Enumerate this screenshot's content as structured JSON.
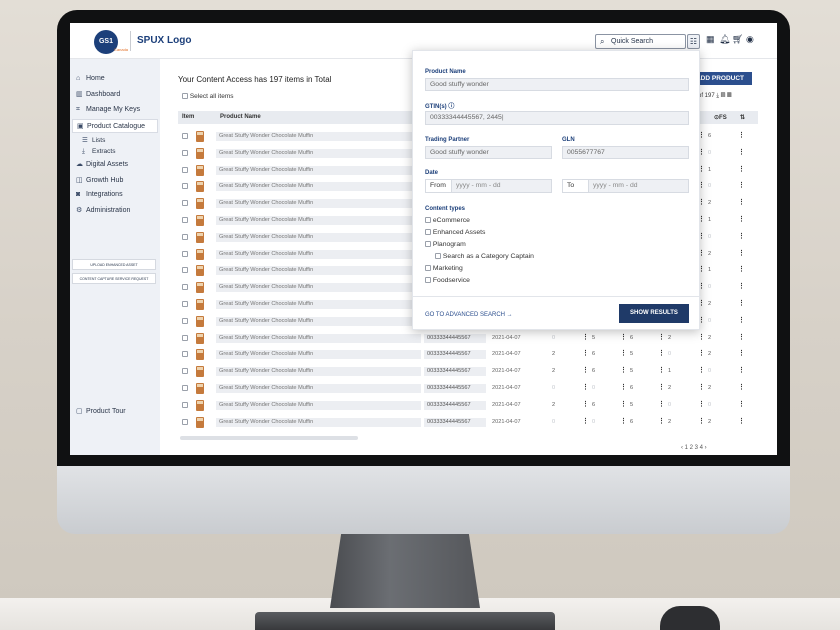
{
  "app": {
    "logo_text": "SPUX Logo",
    "logo_mark": "GS1",
    "logo_sub": "Canada"
  },
  "topbar": {
    "search_placeholder": "Quick Search"
  },
  "sidebar": {
    "items": [
      {
        "label": "Home",
        "icon": "home-icon"
      },
      {
        "label": "Dashboard",
        "icon": "chart-icon"
      },
      {
        "label": "Manage My Keys",
        "icon": "key-icon"
      },
      {
        "label": "Product Catalogue",
        "icon": "catalogue-icon",
        "active": true
      },
      {
        "label": "Lists",
        "icon": "list-icon",
        "sub": true
      },
      {
        "label": "Extracts",
        "icon": "download-icon",
        "sub": true
      },
      {
        "label": "Digital Assets",
        "icon": "cloud-icon"
      },
      {
        "label": "Growth Hub",
        "icon": "growth-icon"
      },
      {
        "label": "Integrations",
        "icon": "integration-icon"
      },
      {
        "label": "Administration",
        "icon": "gear-icon"
      }
    ],
    "upload_button": "UPLOAD ENHANCED ASSET",
    "capture_button": "CONTENT CAPTURE SERVICE REQUEST",
    "product_tour": "Product Tour"
  },
  "main": {
    "title": "Your Content Access has 197 items in Total",
    "select_all": "Select all items",
    "add_product": "ADD PRODUCT",
    "count": "of 197",
    "columns": {
      "item": "Item",
      "name": "Product Name",
      "fs": "FS"
    },
    "pager": "‹  1  2  3  4  ›"
  },
  "table": {
    "rows": [
      {
        "name": "Great Stuffy Wonder Chocolate Muffin",
        "gtin": "",
        "date": "",
        "n1": "",
        "n2": "",
        "n3": "",
        "n4": "6"
      },
      {
        "name": "Great Stuffy Wonder Chocolate Muffin",
        "gtin": "",
        "date": "",
        "n1": "",
        "n2": "",
        "n3": "",
        "n4": "0"
      },
      {
        "name": "Great Stuffy Wonder Chocolate Muffin",
        "gtin": "",
        "date": "",
        "n1": "",
        "n2": "",
        "n3": "",
        "n4": "1"
      },
      {
        "name": "Great Stuffy Wonder Chocolate Muffin",
        "gtin": "",
        "date": "",
        "n1": "",
        "n2": "",
        "n3": "",
        "n4": "0"
      },
      {
        "name": "Great Stuffy Wonder Chocolate Muffin",
        "gtin": "",
        "date": "",
        "n1": "",
        "n2": "",
        "n3": "",
        "n4": "2"
      },
      {
        "name": "Great Stuffy Wonder Chocolate Muffin",
        "gtin": "",
        "date": "",
        "n1": "",
        "n2": "",
        "n3": "",
        "n4": "1"
      },
      {
        "name": "Great Stuffy Wonder Chocolate Muffin",
        "gtin": "",
        "date": "",
        "n1": "",
        "n2": "",
        "n3": "",
        "n4": "0"
      },
      {
        "name": "Great Stuffy Wonder Chocolate Muffin",
        "gtin": "",
        "date": "",
        "n1": "",
        "n2": "",
        "n3": "",
        "n4": "2"
      },
      {
        "name": "Great Stuffy Wonder Chocolate Muffin",
        "gtin": "",
        "date": "",
        "n1": "",
        "n2": "",
        "n3": "",
        "n4": "1"
      },
      {
        "name": "Great Stuffy Wonder Chocolate Muffin",
        "gtin": "",
        "date": "",
        "n1": "",
        "n2": "",
        "n3": "",
        "n4": "0"
      },
      {
        "name": "Great Stuffy Wonder Chocolate Muffin",
        "gtin": "",
        "date": "",
        "n1": "",
        "n2": "",
        "n3": "",
        "n4": "2"
      },
      {
        "name": "Great Stuffy Wonder Chocolate Muffin",
        "gtin": "",
        "date": "",
        "n1": "",
        "n2": "",
        "n3": "",
        "n4": "0"
      },
      {
        "name": "Great Stuffy Wonder Chocolate Muffin",
        "gtin": "00333344445567",
        "date": "2021-04-07",
        "n1": "0",
        "n2": "5",
        "n3": "6",
        "n4": "2",
        "n5": "2"
      },
      {
        "name": "Great Stuffy Wonder Chocolate Muffin",
        "gtin": "00333344445567",
        "date": "2021-04-07",
        "n1": "2",
        "n2": "6",
        "n3": "5",
        "n4": "0",
        "n5": "2"
      },
      {
        "name": "Great Stuffy Wonder Chocolate Muffin",
        "gtin": "00333344445567",
        "date": "2021-04-07",
        "n1": "2",
        "n2": "6",
        "n3": "5",
        "n4": "1",
        "n5": "0"
      },
      {
        "name": "Great Stuffy Wonder Chocolate Muffin",
        "gtin": "00333344445567",
        "date": "2021-04-07",
        "n1": "0",
        "n2": "0",
        "n3": "6",
        "n4": "2",
        "n5": "2"
      },
      {
        "name": "Great Stuffy Wonder Chocolate Muffin",
        "gtin": "00333344445567",
        "date": "2021-04-07",
        "n1": "2",
        "n2": "6",
        "n3": "5",
        "n4": "0",
        "n5": "0"
      },
      {
        "name": "Great Stuffy Wonder Chocolate Muffin",
        "gtin": "00333344445567",
        "date": "2021-04-07",
        "n1": "0",
        "n2": "0",
        "n3": "6",
        "n4": "2",
        "n5": "2"
      }
    ]
  },
  "search_panel": {
    "product_name_label": "Product Name",
    "product_name_value": "Good stuffy wonder",
    "gtin_label": "GTIN(s) ⓘ",
    "gtin_value": "00333344445567, 2445|",
    "trading_partner_label": "Trading Partner",
    "trading_partner_value": "Good stuffy wonder",
    "gln_label": "GLN",
    "gln_value": "0055677767",
    "date_label": "Date",
    "from_label": "From",
    "to_label": "To",
    "date_placeholder": "yyyy - mm - dd",
    "content_types_label": "Content types",
    "content_types": [
      "eCommerce",
      "Enhanced Assets",
      "Planogram",
      "Search as a Category Captain",
      "Marketing",
      "Foodservice"
    ],
    "advanced_link": "GO TO ADVANCED SEARCH →",
    "show_results": "SHOW RESULTS"
  },
  "colors": {
    "brand": "#1c3f7a",
    "accent": "#2c4f8e",
    "button_dark": "#1f3a68"
  }
}
